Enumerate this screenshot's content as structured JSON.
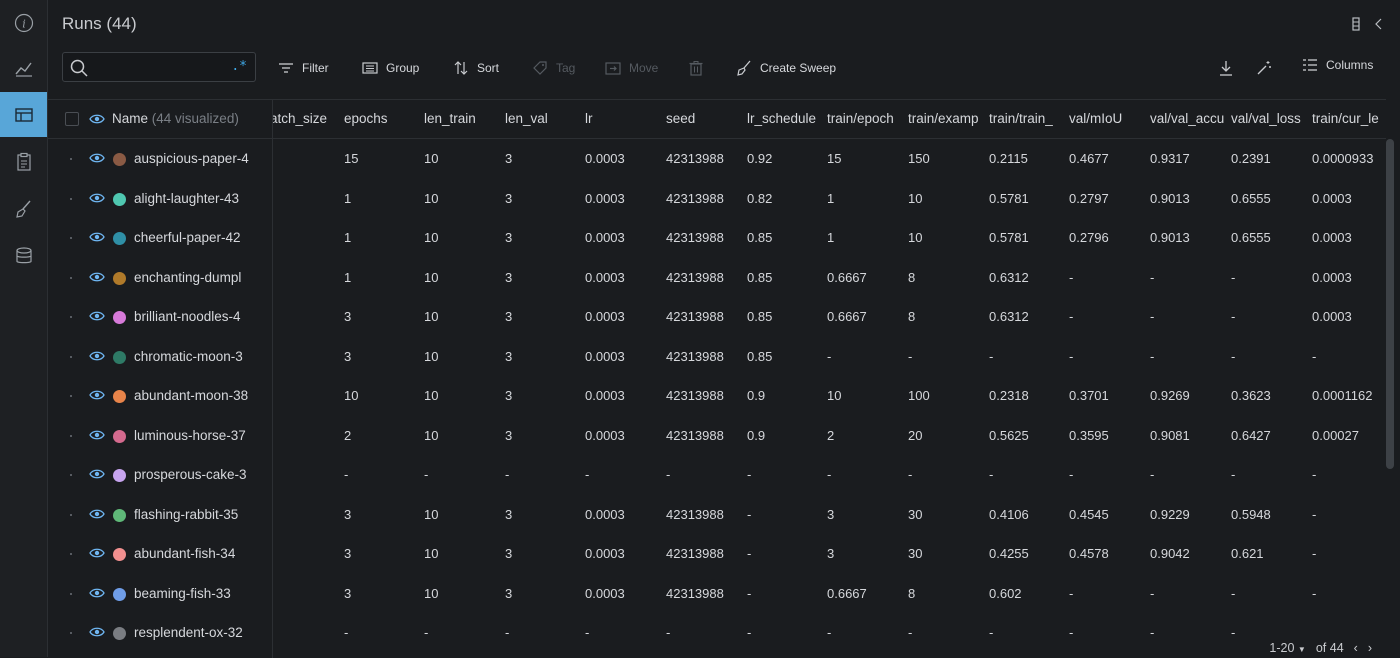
{
  "panel": {
    "title": "Runs (44)",
    "search": {
      "value": "",
      "placeholder": "",
      "regex_label": ".*"
    }
  },
  "toolbar": {
    "filter": "Filter",
    "group": "Group",
    "sort": "Sort",
    "tag": "Tag",
    "move": "Move",
    "create_sweep": "Create Sweep",
    "columns": "Columns"
  },
  "table": {
    "name_header": "Name",
    "name_header_count": "(44 visualized)",
    "columns": [
      "atch_size",
      "epochs",
      "len_train",
      "len_val",
      "lr",
      "seed",
      "lr_schedule",
      "train/epoch",
      "train/examp",
      "train/train_",
      "val/mIoU",
      "val/val_accu",
      "val/val_loss",
      "train/cur_le"
    ],
    "rows": [
      {
        "name": "auspicious-paper-4",
        "color": "#8a5a44",
        "cells": [
          "",
          "15",
          "10",
          "3",
          "0.0003",
          "42313988",
          "0.92",
          "15",
          "150",
          "0.2115",
          "0.4677",
          "0.9317",
          "0.2391",
          "0.0000933"
        ]
      },
      {
        "name": "alight-laughter-43",
        "color": "#4fc7b0",
        "cells": [
          "",
          "1",
          "10",
          "3",
          "0.0003",
          "42313988",
          "0.82",
          "1",
          "10",
          "0.5781",
          "0.2797",
          "0.9013",
          "0.6555",
          "0.0003"
        ]
      },
      {
        "name": "cheerful-paper-42",
        "color": "#2f8fa6",
        "cells": [
          "",
          "1",
          "10",
          "3",
          "0.0003",
          "42313988",
          "0.85",
          "1",
          "10",
          "0.5781",
          "0.2796",
          "0.9013",
          "0.6555",
          "0.0003"
        ]
      },
      {
        "name": "enchanting-dumpl",
        "color": "#b07a2a",
        "cells": [
          "",
          "1",
          "10",
          "3",
          "0.0003",
          "42313988",
          "0.85",
          "0.6667",
          "8",
          "0.6312",
          "-",
          "-",
          "-",
          "0.0003"
        ]
      },
      {
        "name": "brilliant-noodles-4",
        "color": "#d77ad9",
        "cells": [
          "",
          "3",
          "10",
          "3",
          "0.0003",
          "42313988",
          "0.85",
          "0.6667",
          "8",
          "0.6312",
          "-",
          "-",
          "-",
          "0.0003"
        ]
      },
      {
        "name": "chromatic-moon-3",
        "color": "#2e7a66",
        "cells": [
          "",
          "3",
          "10",
          "3",
          "0.0003",
          "42313988",
          "0.85",
          "-",
          "-",
          "-",
          "-",
          "-",
          "-",
          "-"
        ]
      },
      {
        "name": "abundant-moon-38",
        "color": "#e8844a",
        "cells": [
          "",
          "10",
          "10",
          "3",
          "0.0003",
          "42313988",
          "0.9",
          "10",
          "100",
          "0.2318",
          "0.3701",
          "0.9269",
          "0.3623",
          "0.0001162"
        ]
      },
      {
        "name": "luminous-horse-37",
        "color": "#d46a8e",
        "cells": [
          "",
          "2",
          "10",
          "3",
          "0.0003",
          "42313988",
          "0.9",
          "2",
          "20",
          "0.5625",
          "0.3595",
          "0.9081",
          "0.6427",
          "0.00027"
        ]
      },
      {
        "name": "prosperous-cake-3",
        "color": "#c7a4ef",
        "cells": [
          "",
          "-",
          "-",
          "-",
          "-",
          "-",
          "-",
          "-",
          "-",
          "-",
          "-",
          "-",
          "-",
          "-"
        ]
      },
      {
        "name": "flashing-rabbit-35",
        "color": "#5fb878",
        "cells": [
          "",
          "3",
          "10",
          "3",
          "0.0003",
          "42313988",
          "-",
          "3",
          "30",
          "0.4106",
          "0.4545",
          "0.9229",
          "0.5948",
          "-"
        ]
      },
      {
        "name": "abundant-fish-34",
        "color": "#f29090",
        "cells": [
          "",
          "3",
          "10",
          "3",
          "0.0003",
          "42313988",
          "-",
          "3",
          "30",
          "0.4255",
          "0.4578",
          "0.9042",
          "0.621",
          "-"
        ]
      },
      {
        "name": "beaming-fish-33",
        "color": "#6f9de8",
        "cells": [
          "",
          "3",
          "10",
          "3",
          "0.0003",
          "42313988",
          "-",
          "0.6667",
          "8",
          "0.602",
          "-",
          "-",
          "-",
          "-"
        ]
      },
      {
        "name": "resplendent-ox-32",
        "color": "#7a7d82",
        "cells": [
          "",
          "-",
          "-",
          "-",
          "-",
          "-",
          "-",
          "-",
          "-",
          "-",
          "-",
          "-",
          "-",
          ""
        ]
      }
    ]
  },
  "pagination": {
    "range": "1-20",
    "total": "of 44"
  },
  "colors": {
    "accent": "#58a6d8",
    "eye": "#6fb6f2",
    "regex": "#3fa9e8"
  }
}
